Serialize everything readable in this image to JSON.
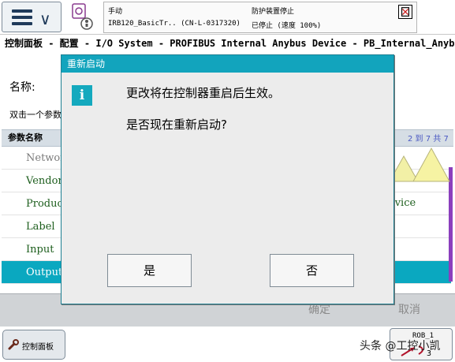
{
  "header": {
    "mode": "手动",
    "robot_name": "IRB120_BasicTr.. (CN-L-0317320)",
    "safety": "防护装置停止",
    "status": "已停止 (速度 100%)"
  },
  "breadcrumb": "控制面板 - 配置 - I/O System - PROFIBUS Internal Anybus Device - PB_Internal_Anybus",
  "background": {
    "name_label": "名称:",
    "hint": "双击一个参数",
    "column_header": "参数名称",
    "range": "2 到 7 共 7",
    "rows": [
      "Network",
      "Vendor",
      "Product",
      "Label",
      "Input",
      "Output"
    ],
    "value_device": "evice",
    "ok_label": "确定",
    "cancel_label": "取消"
  },
  "taskbar": {
    "control_panel": "控制面板",
    "rob_label": "ROB_1",
    "watermark": "头条 @工控小凯"
  },
  "dialog": {
    "title": "重新启动",
    "icon": "i",
    "message_1": "更改将在控制器重启后生效。",
    "message_2": "是否现在重新启动?",
    "yes_label": "是",
    "no_label": "否"
  },
  "colors": {
    "accent": "#12a4bd",
    "row_selected": "#0aa8c0",
    "row_green": "#1d5e1d",
    "row_gray": "#7a7a7a"
  }
}
